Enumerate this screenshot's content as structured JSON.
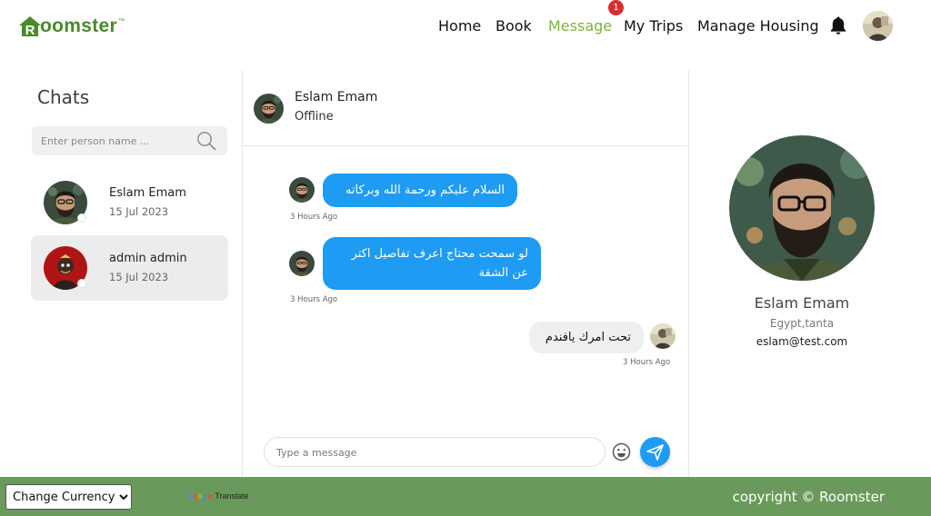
{
  "header": {
    "logo_text": "oomster",
    "logo_tm": "™",
    "nav": [
      {
        "label": "Home"
      },
      {
        "label": "Book"
      },
      {
        "label": "Message"
      },
      {
        "label": "My Trips"
      },
      {
        "label": "Manage Housing"
      }
    ],
    "message_badge": "1",
    "icons": [
      "bell-icon",
      "user-avatar"
    ]
  },
  "sidebar": {
    "title": "Chats",
    "search_placeholder": "Enter person name ...",
    "chats": [
      {
        "name": "Eslam Emam",
        "date": "15 Jul 2023"
      },
      {
        "name": "admin admin",
        "date": "15 Jul 2023"
      }
    ]
  },
  "conversation": {
    "name": "Eslam Emam",
    "status": "Offline",
    "messages": [
      {
        "text": "السلام عليكم ورحمة الله وبركاته",
        "time": "3 Hours Ago",
        "direction": "incoming"
      },
      {
        "text": "لو سمحت محتاج اعرف تفاصيل اكتر عن الشقة",
        "time": "3 Hours Ago",
        "direction": "incoming"
      },
      {
        "text": "تحت امرك يافندم",
        "time": "3 Hours Ago",
        "direction": "outgoing"
      }
    ],
    "composer_placeholder": "Type a message"
  },
  "profile": {
    "name": "Eslam Emam",
    "location": "Egypt,tanta",
    "email": "eslam@test.com"
  },
  "footer": {
    "currency_label": "Change Currency",
    "translate_label": "Translate",
    "google_label": "Google",
    "copyright": "copyright © Roomster"
  },
  "colors": {
    "brand_green": "#4a8a2c",
    "active_nav": "#7cb342",
    "bubble_blue": "#1e9bf3",
    "footer_green": "#6a9a5b",
    "badge_red": "#d63031"
  }
}
